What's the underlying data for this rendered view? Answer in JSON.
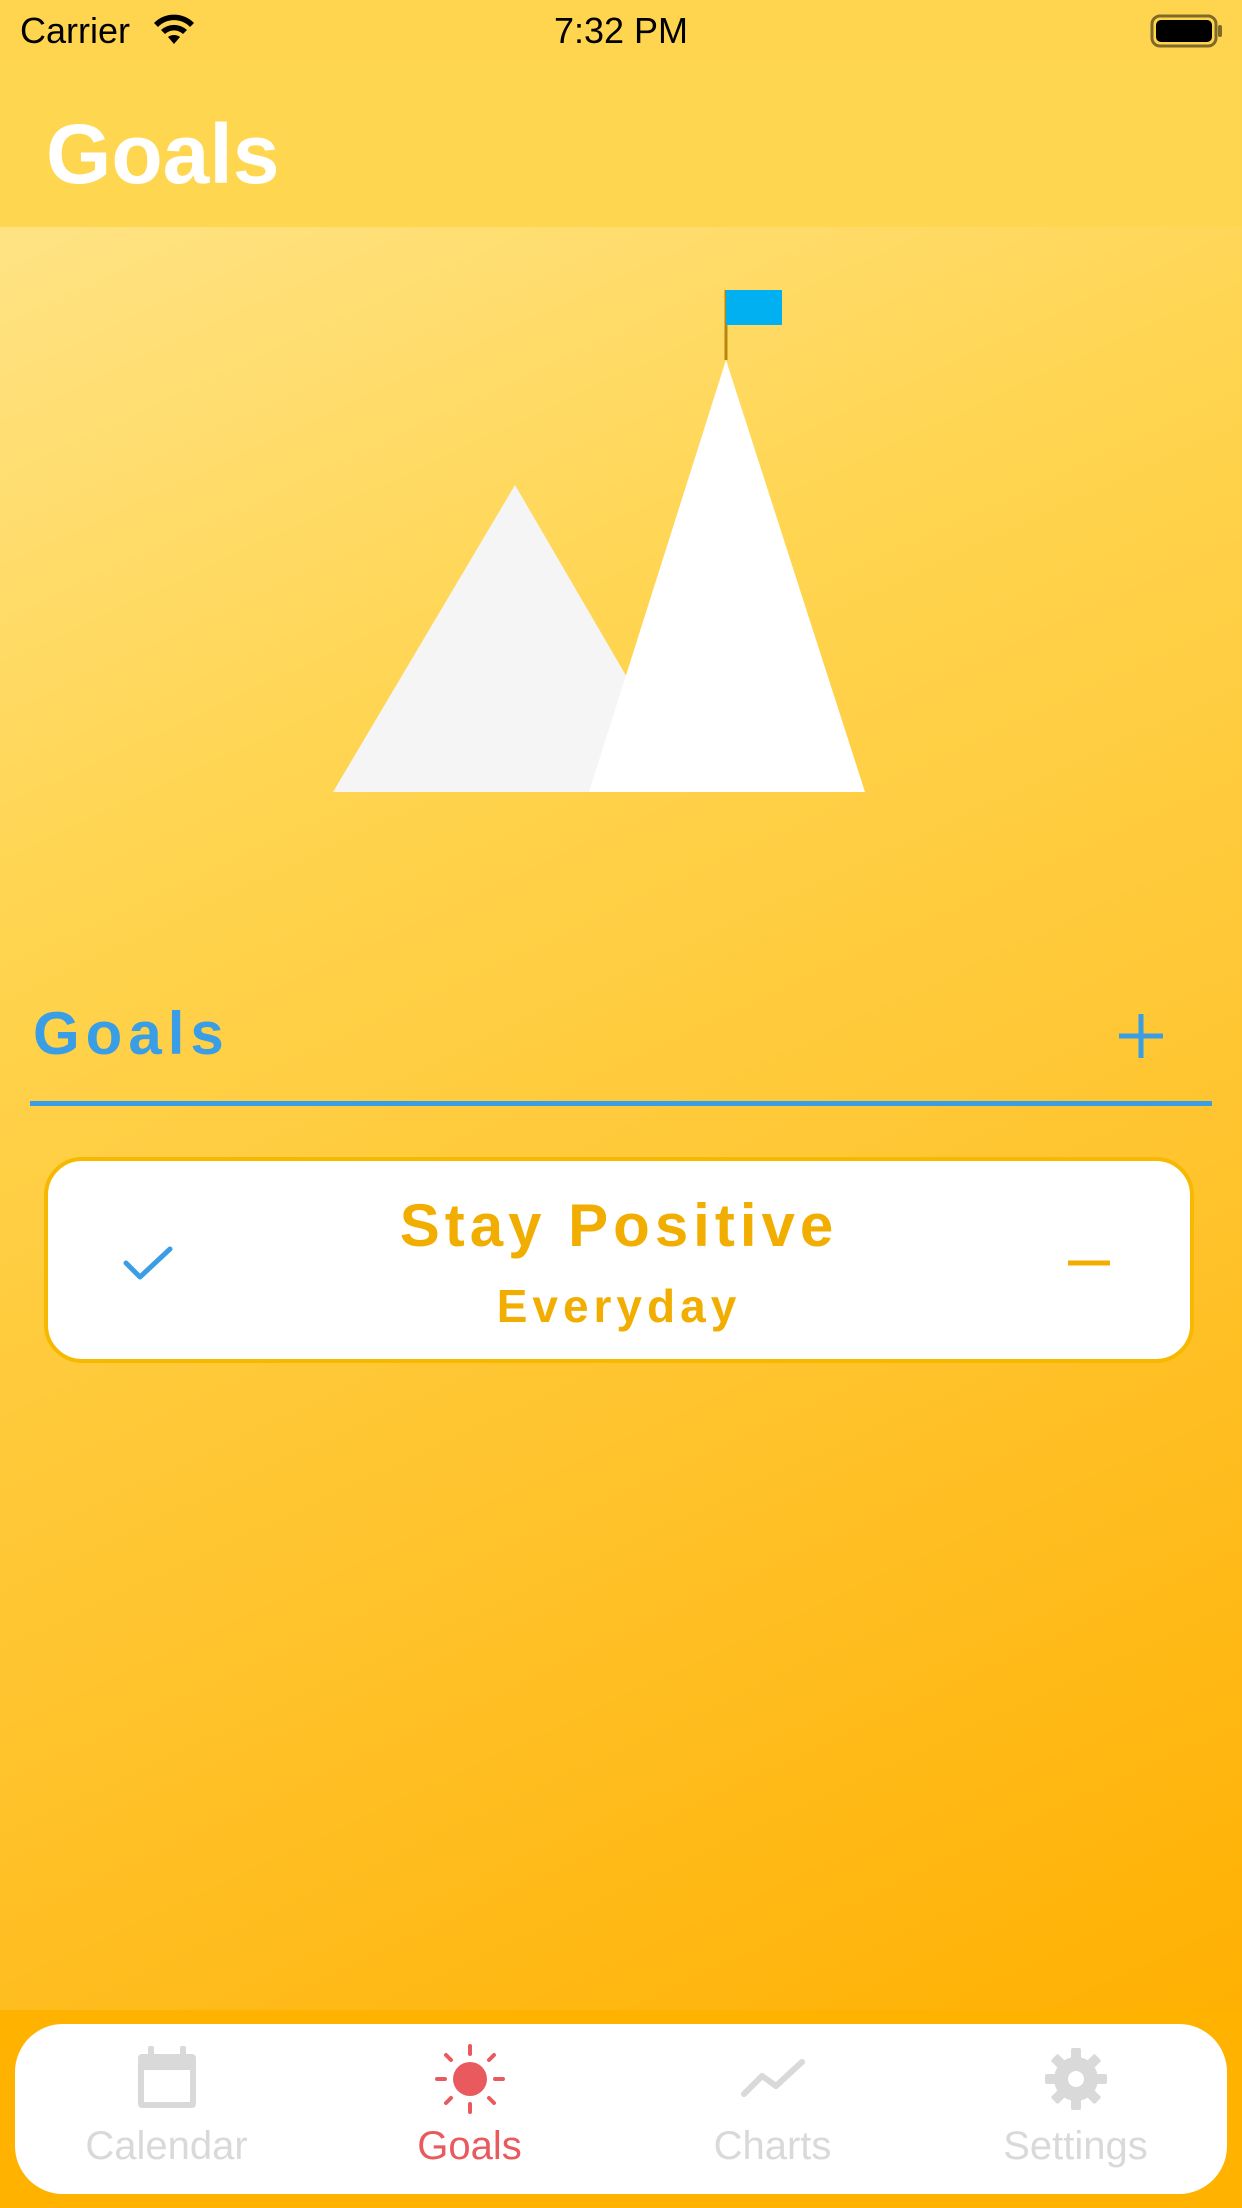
{
  "status_bar": {
    "carrier": "Carrier",
    "time": "7:32 PM"
  },
  "nav": {
    "title": "Goals"
  },
  "section": {
    "title": "Goals",
    "add_icon": "plus-icon"
  },
  "goals": [
    {
      "title": "Stay Positive",
      "frequency": "Everyday",
      "completed": true
    }
  ],
  "tabs": [
    {
      "label": "Calendar",
      "icon": "calendar-icon",
      "active": false
    },
    {
      "label": "Goals",
      "icon": "sun-icon",
      "active": true
    },
    {
      "label": "Charts",
      "icon": "chart-line-icon",
      "active": false
    },
    {
      "label": "Settings",
      "icon": "gear-icon",
      "active": false
    }
  ],
  "colors": {
    "accent_blue": "#3a9ee6",
    "goal_text": "#f2ae00",
    "active_tab": "#e85a5e",
    "inactive_tab": "#d9d9d9",
    "flag": "#00b0f0"
  }
}
